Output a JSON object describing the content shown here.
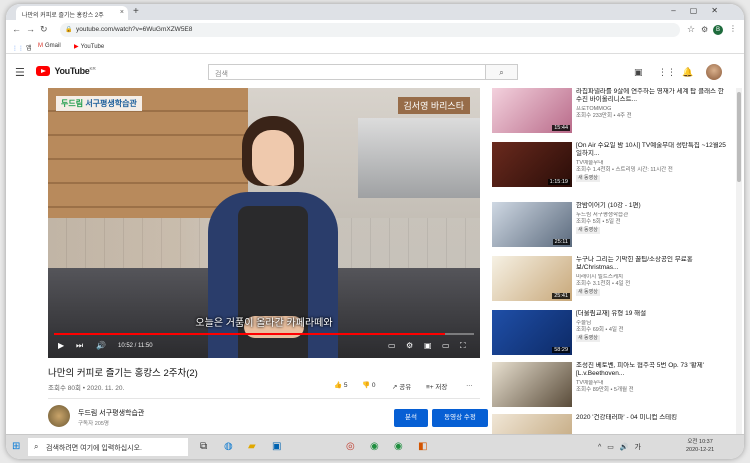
{
  "browser": {
    "tab_title": "나만의 커피로 즐기는 홍캉스 2주",
    "tab_close": "×",
    "new_tab": "+",
    "url": "youtube.com/watch?v=6WuGmXZW5E8",
    "bookmarks": [
      {
        "icon": "apps-icon",
        "label": "앱"
      },
      {
        "icon": "gmail-icon",
        "label": "Gmail"
      },
      {
        "icon": "youtube-icon",
        "label": "YouTube"
      }
    ]
  },
  "youtube": {
    "logo_word": "YouTube",
    "logo_region": "KR",
    "search_placeholder": "검색"
  },
  "video": {
    "logo_overlay_g": "두드림",
    "logo_overlay_rest": " 서구평생학습관",
    "barista_tag": "김서영 바리스타",
    "subtitle": "오늘은 거품이 올라간 카페라떼와",
    "time": "10:52 / 11:50",
    "progress": 0.93,
    "title": "나만의 커피로 즐기는 홍캉스 2주차(2)",
    "views": "조회수 80회 • 2020. 11. 20.",
    "likes": "5",
    "dislikes": "0",
    "share_label": "공유",
    "save_label": "저장",
    "more_label": "…"
  },
  "channel": {
    "name": "두드림 서구평생학습관",
    "subscribers": "구독자 205명",
    "analytics_label": "분석",
    "edit_label": "동영상 수정"
  },
  "recommendations": [
    {
      "title": "라칩파넬라를 9살에 연주하는 영재가 세계 탑 클래스 한수진 바이올리니스트...",
      "channel": "프로TOMMOG",
      "meta": "조회수 233만회 • 4주 전",
      "duration": "15:44",
      "badge": ""
    },
    {
      "title": "[On Air 수요일 밤 10시] TV예술무대 성탄특집 ~12월25일하지...",
      "channel": "TV예술무대",
      "meta": "조회수 1.4천회 • 스트리밍 시간: 11시간 전",
      "duration": "1:15:19",
      "badge": "새 동영상"
    },
    {
      "title": "한밤이어기 (10강 - 1편)",
      "channel": "두드림 서구평생학습관",
      "meta": "조회수 5회 • 5일 전",
      "duration": "25:11",
      "badge": "새 동영상"
    },
    {
      "title": "누구나 그리는 기막힌 꿀팁/소상공인 무료홍보/Christmas...",
      "channel": "미래이지 빌트스케치",
      "meta": "조회수 3.1천회 • 4일 전",
      "duration": "25:41",
      "badge": "새 동영상"
    },
    {
      "title": "[더울림교재] 유형 19 해설",
      "channel": "수울님",
      "meta": "조회수 69회 • 4일 전",
      "duration": "58:29",
      "badge": "새 동영상"
    },
    {
      "title": "조성진 베토벤, 피아노 협주곡 5번 Op. 73 '황제' [L.v.Beethoven...",
      "channel": "TV예술무대",
      "meta": "조회수 89만회 • 5개월 전",
      "duration": "",
      "badge": ""
    },
    {
      "title": "2020 '건강태러파' - 04 미니컵 스테킹",
      "channel": "",
      "meta": "",
      "duration": "",
      "badge": ""
    }
  ],
  "taskbar": {
    "search_placeholder": "검색하려면 여기에 입력하십시오.",
    "clock_time": "오전 10:37",
    "clock_date": "2020-12-21"
  },
  "colors": {
    "accent": "#065fd4",
    "youtube_red": "#ff0000"
  }
}
